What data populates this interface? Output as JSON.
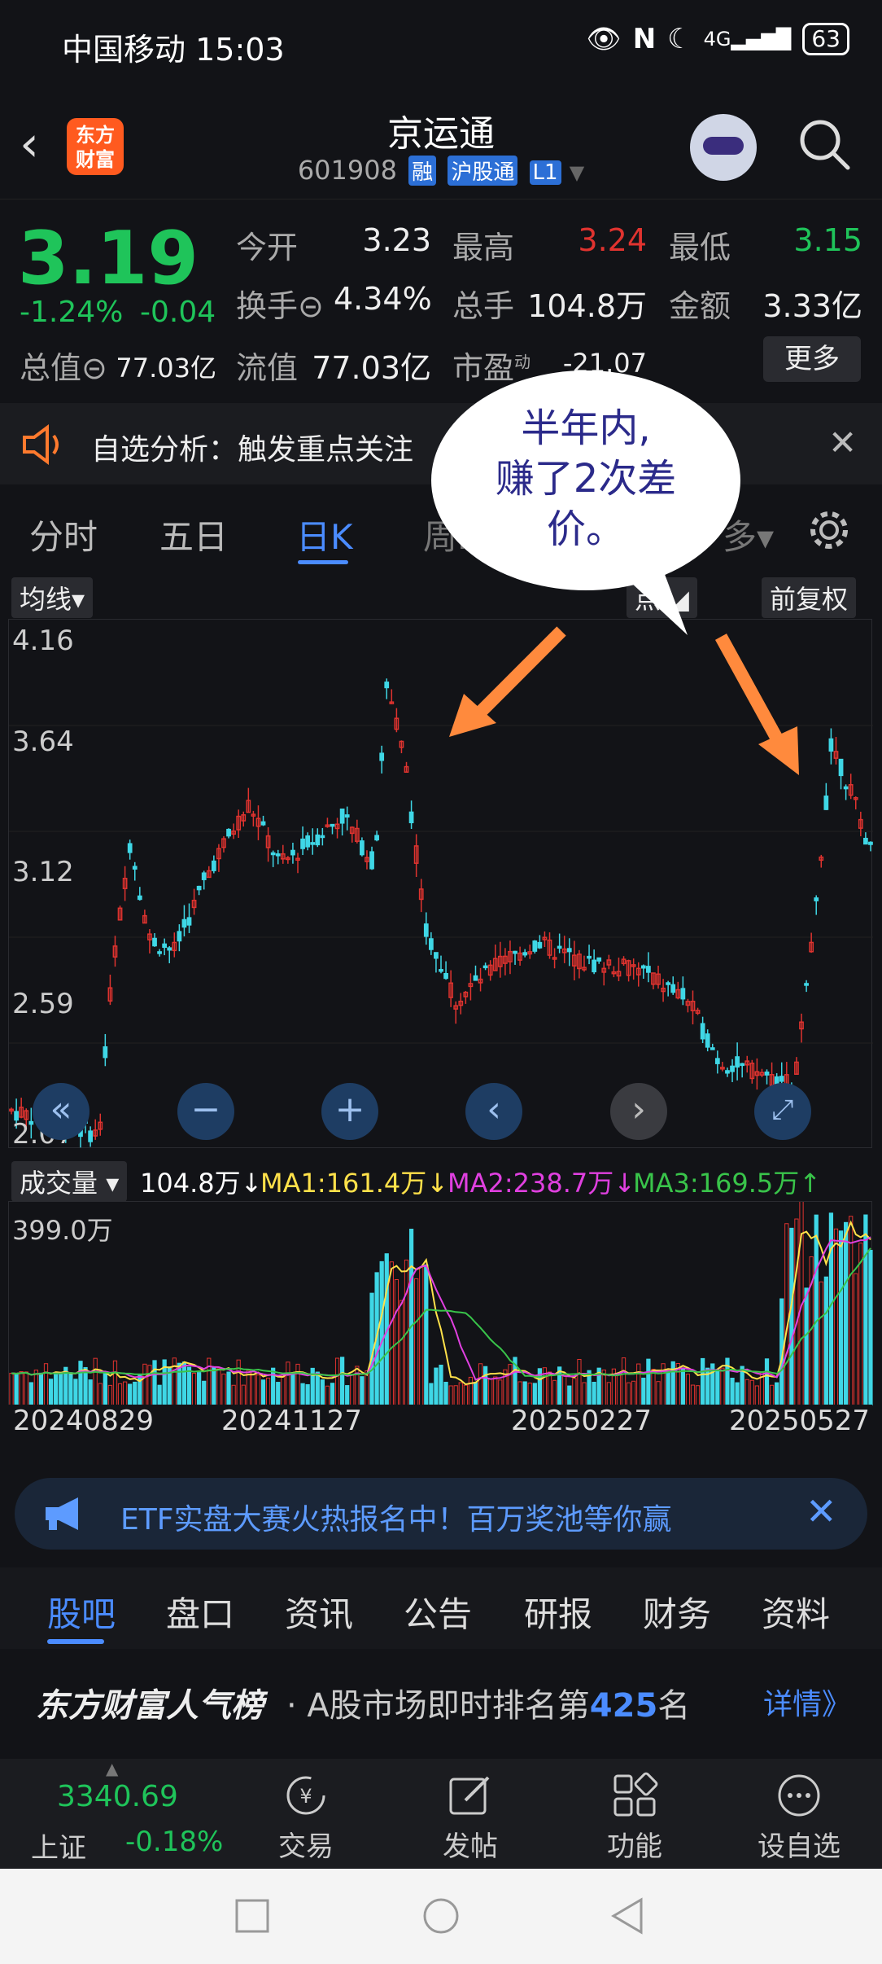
{
  "status_bar": {
    "carrier": "中国移动",
    "time": "15:03",
    "battery": "63",
    "net": "4G"
  },
  "header": {
    "title": "京运通",
    "code": "601908",
    "tags": [
      "融",
      "沪股通",
      "L1"
    ],
    "logo_text": "东方财富"
  },
  "quote": {
    "price": "3.19",
    "change_pct": "-1.24%",
    "change": "-0.04",
    "open_label": "今开",
    "open": "3.23",
    "high_label": "最高",
    "high": "3.24",
    "low_label": "最低",
    "low": "3.15",
    "turnover_label": "换手",
    "turnover": "4.34%",
    "volume_label": "总手",
    "volume": "104.8万",
    "amount_label": "金额",
    "amount": "3.33亿",
    "total_value_label": "总值",
    "total_value": "77.03亿",
    "float_value_label": "流值",
    "float_value": "77.03亿",
    "pe_label": "市盈",
    "pe_sup": "动",
    "pe": "-21.07",
    "more": "更多"
  },
  "notice": {
    "text": "自选分析：触发重点关注"
  },
  "tabs": {
    "items": [
      "分时",
      "五日",
      "日K",
      "周K",
      "多"
    ],
    "active": "日K"
  },
  "chart_tools": {
    "indicator": "均线",
    "points": "点",
    "adjust": "前复权"
  },
  "kline": {
    "y_ticks": [
      "4.16",
      "3.64",
      "3.12",
      "2.59",
      "2.07"
    ]
  },
  "volume": {
    "label": "成交量",
    "current": "104.8万↓",
    "ma1": "MA1:161.4万↓",
    "ma2": "MA2:238.7万↓",
    "ma3": "MA3:169.5万↑",
    "max_label": "399.0万",
    "ma1_color": "#ffe14a",
    "ma2_color": "#e040e0",
    "ma3_color": "#39c44a"
  },
  "dates": [
    "20240829",
    "20241127",
    "20250227",
    "20250527"
  ],
  "annotation": {
    "text_line1": "半年内,",
    "text_line2": "赚了2次差",
    "text_line3": "价。"
  },
  "ad": {
    "text": "ETF实盘大赛火热报名中！百万奖池等你赢"
  },
  "sub_tabs": {
    "items": [
      "股吧",
      "盘口",
      "资讯",
      "公告",
      "研报",
      "财务",
      "资料"
    ],
    "active": "股吧"
  },
  "rank": {
    "brand": "东方财富人气榜",
    "prefix": "· A股市场即时排名第",
    "number": "425",
    "suffix": "名",
    "detail": "详情》"
  },
  "bottom_bar": {
    "index_value": "3340.69",
    "index_name": "上证",
    "index_change": "-0.18%",
    "nav": [
      "交易",
      "发帖",
      "功能",
      "设自选"
    ]
  },
  "colors": {
    "up": "#e0332f",
    "down": "#3fd7e6",
    "green": "#1fc45a",
    "accent": "#4b8cff"
  }
}
